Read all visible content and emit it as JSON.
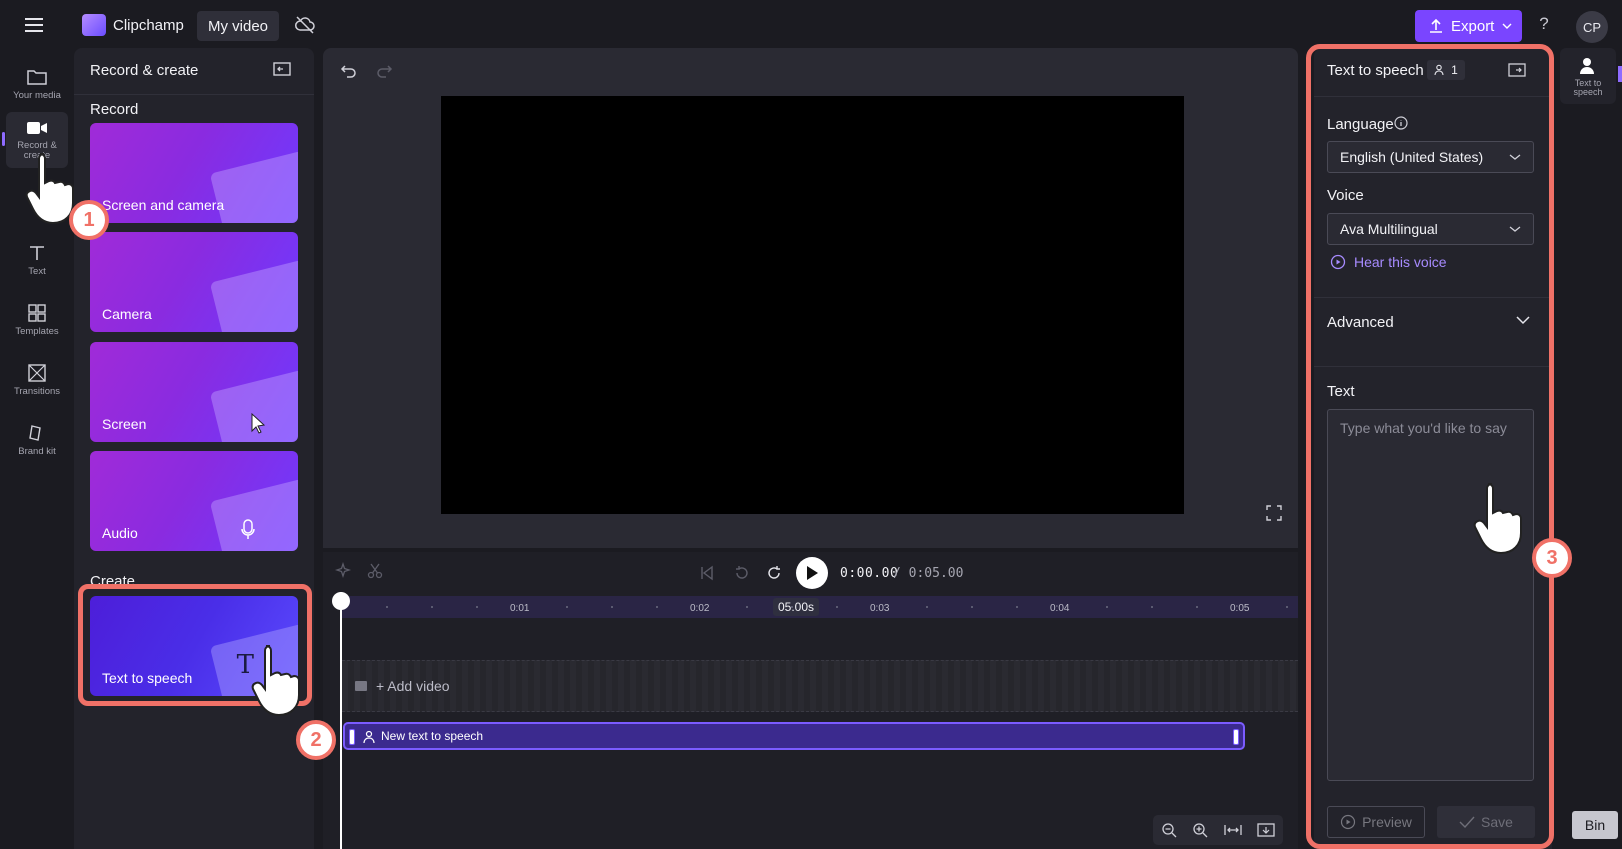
{
  "app": {
    "name": "Clipchamp",
    "video_tab": "My video",
    "export_label": "Export",
    "help": "?",
    "avatar": "CP"
  },
  "nav": {
    "items": [
      {
        "label": "Your media",
        "icon": "folder-icon"
      },
      {
        "label": "Record & create",
        "icon": "video-camera-icon"
      },
      {
        "label": "Text",
        "icon": "text-icon"
      },
      {
        "label": "Templates",
        "icon": "templates-icon"
      },
      {
        "label": "Transitions",
        "icon": "transitions-icon"
      },
      {
        "label": "Brand kit",
        "icon": "brand-kit-icon"
      }
    ]
  },
  "panel": {
    "title": "Record & create",
    "record_label": "Record",
    "create_label": "Create",
    "cards": [
      {
        "label": "Screen and camera"
      },
      {
        "label": "Camera"
      },
      {
        "label": "Screen"
      },
      {
        "label": "Audio"
      },
      {
        "label": "Text to speech"
      }
    ]
  },
  "timeline": {
    "current_time": "0:00.00",
    "total_time": "/ 0:05.00",
    "ticks": [
      "0:01",
      "0:02",
      "0:03",
      "0:04",
      "0:05"
    ],
    "zoom_tag": "05.00s",
    "add_video": "+ Add video",
    "clip_label": "New text to speech"
  },
  "tts": {
    "title": "Text to speech",
    "badge_count": "1",
    "language_label": "Language",
    "language_value": "English (United States)",
    "voice_label": "Voice",
    "voice_value": "Ava Multilingual",
    "hear_voice": "Hear this voice",
    "advanced_label": "Advanced",
    "text_label": "Text",
    "text_placeholder": "Type what you'd like to say",
    "preview_label": "Preview",
    "save_label": "Save"
  },
  "mini": {
    "tts_label": "Text to speech",
    "bin_label": "Bin"
  },
  "steps": [
    "1",
    "2",
    "3"
  ],
  "colors": {
    "accent": "#7a45ff",
    "highlight": "#f07167",
    "clip": "#3b2a8e"
  }
}
